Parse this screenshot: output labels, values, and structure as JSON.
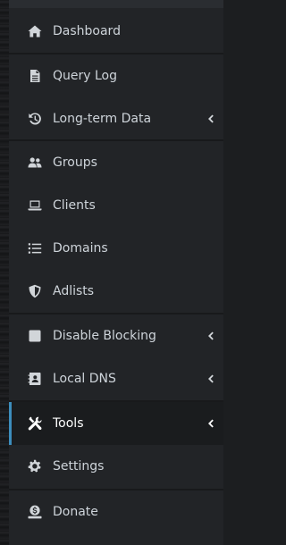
{
  "sidebar": {
    "items": [
      {
        "label": "Dashboard",
        "icon": "home-icon"
      },
      {
        "label": "Query Log",
        "icon": "file-icon"
      },
      {
        "label": "Long-term Data",
        "icon": "history-icon"
      },
      {
        "label": "Groups",
        "icon": "users-icon"
      },
      {
        "label": "Clients",
        "icon": "laptop-icon"
      },
      {
        "label": "Domains",
        "icon": "list-icon"
      },
      {
        "label": "Adlists",
        "icon": "shield-icon"
      },
      {
        "label": "Disable Blocking",
        "icon": "stop-square-icon"
      },
      {
        "label": "Local DNS",
        "icon": "address-book-icon"
      },
      {
        "label": "Tools",
        "icon": "tools-icon"
      },
      {
        "label": "Settings",
        "icon": "gear-icon"
      },
      {
        "label": "Donate",
        "icon": "donate-icon"
      }
    ],
    "active_item": "Tools",
    "accent_color": "#3c8dbc"
  }
}
